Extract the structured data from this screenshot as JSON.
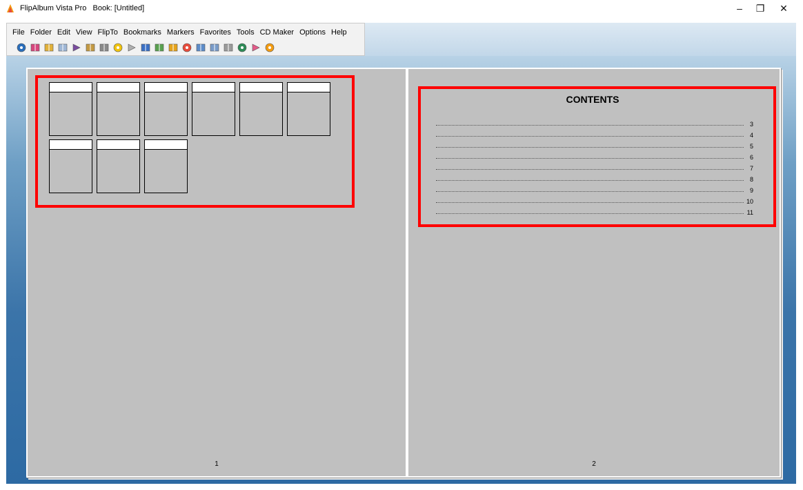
{
  "window": {
    "app_name": "FlipAlbum Vista Pro",
    "title": "FlipAlbum Vista Pro   Book: [Untitled]",
    "controls": {
      "minimize": "–",
      "restore": "❐",
      "close": "✕"
    }
  },
  "menubar": {
    "items": [
      "File",
      "Folder",
      "Edit",
      "View",
      "FlipTo",
      "Bookmarks",
      "Markers",
      "Favorites",
      "Tools",
      "CD Maker",
      "Options",
      "Help"
    ]
  },
  "toolbar": {
    "buttons": [
      {
        "name": "view-eye-icon",
        "color": "#2a6ebb"
      },
      {
        "name": "book-pink-icon",
        "color": "#d6477d"
      },
      {
        "name": "open-book-icon",
        "color": "#e2b23a"
      },
      {
        "name": "single-page-icon",
        "color": "#9fb7d6"
      },
      {
        "name": "next-arrow-icon",
        "color": "#7a4ca0"
      },
      {
        "name": "two-pages-icon",
        "color": "#c49a43"
      },
      {
        "name": "printer-icon",
        "color": "#8a8a8a"
      },
      {
        "name": "yellow-circle-icon",
        "color": "#f1c40f"
      },
      {
        "name": "flip-back-icon",
        "color": "#b0b0b0"
      },
      {
        "name": "blue-blocks-icon",
        "color": "#3a6fc4"
      },
      {
        "name": "pen-icon",
        "color": "#59a14f"
      },
      {
        "name": "album-icon",
        "color": "#e5a31b"
      },
      {
        "name": "red-circle-icon",
        "color": "#e74c3c"
      },
      {
        "name": "insert-page-icon",
        "color": "#5d8cc9"
      },
      {
        "name": "remove-page-icon",
        "color": "#7a9cc9"
      },
      {
        "name": "thumbnail-icon",
        "color": "#9c9c9c"
      },
      {
        "name": "globe-icon",
        "color": "#2e8b57"
      },
      {
        "name": "pointer-icon",
        "color": "#e45b8a"
      },
      {
        "name": "burn-cd-icon",
        "color": "#f39c12"
      }
    ]
  },
  "book": {
    "left_page": {
      "page_number": "1",
      "thumbnail_count": 9
    },
    "right_page": {
      "page_number": "2",
      "contents_title": "CONTENTS",
      "contents_entries": [
        "3",
        "4",
        "5",
        "6",
        "7",
        "8",
        "9",
        "10",
        "11"
      ]
    }
  },
  "colors": {
    "highlight": "#ff0000",
    "page": "#c0c0c0",
    "desktop_blue": "#2d6aa3"
  }
}
